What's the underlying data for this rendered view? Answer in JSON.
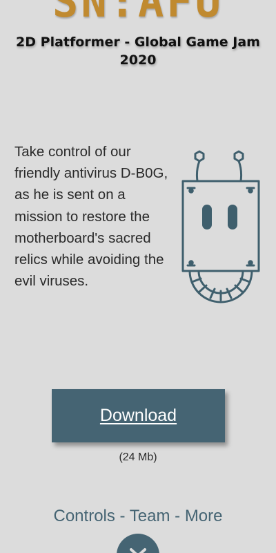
{
  "header": {
    "logo_text": "SN:AFU",
    "subtitle": "2D Platformer - Global Game Jam 2020"
  },
  "main": {
    "description": "Take control of our friendly antivirus D-B0G, as he is sent on a mission to restore the motherboard's sacred relics while avoiding the evil viruses.",
    "mascot_icon": "robot-icon"
  },
  "download": {
    "label": "Download",
    "size": "(24 Mb)"
  },
  "footer_nav": {
    "controls": "Controls",
    "separator": "-",
    "team": "Team",
    "more": "More"
  },
  "scroll_icon": "chevron-down-icon",
  "colors": {
    "background": "#dcdcdc",
    "logo": "#c08a30",
    "accent": "#456473",
    "button_text": "#ffffff"
  }
}
